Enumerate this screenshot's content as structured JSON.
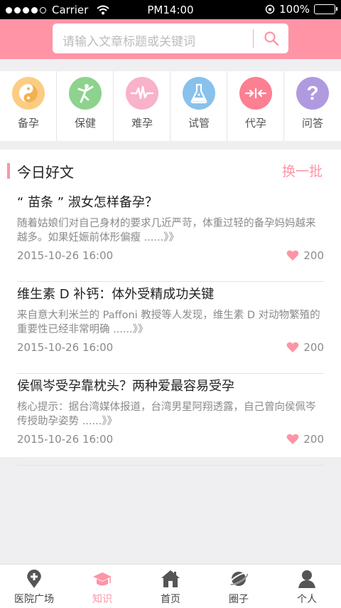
{
  "status": {
    "carrier": "Carrier",
    "time": "PM14:00",
    "battery": "100%"
  },
  "search": {
    "placeholder": "请输入文章标题或关键词"
  },
  "categories": [
    {
      "label": "备孕",
      "icon": "yin-yang-icon",
      "color": "#fccc83"
    },
    {
      "label": "保健",
      "icon": "fitness-figure-icon",
      "color": "#8dd28d"
    },
    {
      "label": "难孕",
      "icon": "heartbeat-icon",
      "color": "#f8b2c9"
    },
    {
      "label": "试管",
      "icon": "flask-icon",
      "color": "#88c1ec"
    },
    {
      "label": "代孕",
      "icon": "arrows-in-icon",
      "color": "#fc7f92"
    },
    {
      "label": "问答",
      "icon": "question-icon",
      "color": "#af9adf"
    }
  ],
  "section": {
    "title": "今日好文",
    "refresh": "换一批"
  },
  "articles": [
    {
      "title": "“ 苗条 ” 淑女怎样备孕？",
      "desc": "随着姑娘们对自己身材的要求几近严苛，体重过轻的备孕妈妈越来越多。如果妊娠前体形偏瘦 ......》》",
      "date": "2015-10-26  16:00",
      "likes": "200"
    },
    {
      "title": "维生素 D 补钙：体外受精成功关键",
      "desc": "来自意大利米兰的 Paffoni 教授等人发现，维生素 D 对动物繁殖的重要性已经非常明确 ......》》",
      "date": "2015-10-26  16:00",
      "likes": "200"
    },
    {
      "title": "侯佩岑受孕靠枕头？两种爱最容易受孕",
      "desc": "核心提示：据台湾媒体报道，台湾男星阿翔透露，自己曾向侯佩岑传授助孕姿势 ......》》",
      "date": "2015-10-26  16:00",
      "likes": "200"
    }
  ],
  "tabs": [
    {
      "label": "医院广场",
      "icon": "hospital-pin-icon"
    },
    {
      "label": "知识",
      "icon": "graduation-cap-icon",
      "active": true
    },
    {
      "label": "首页",
      "icon": "home-icon"
    },
    {
      "label": "圈子",
      "icon": "planet-icon"
    },
    {
      "label": "个人",
      "icon": "person-icon"
    }
  ],
  "colors": {
    "accent": "#fe94a6",
    "text": "#222222",
    "muted": "#8a8a8a"
  }
}
